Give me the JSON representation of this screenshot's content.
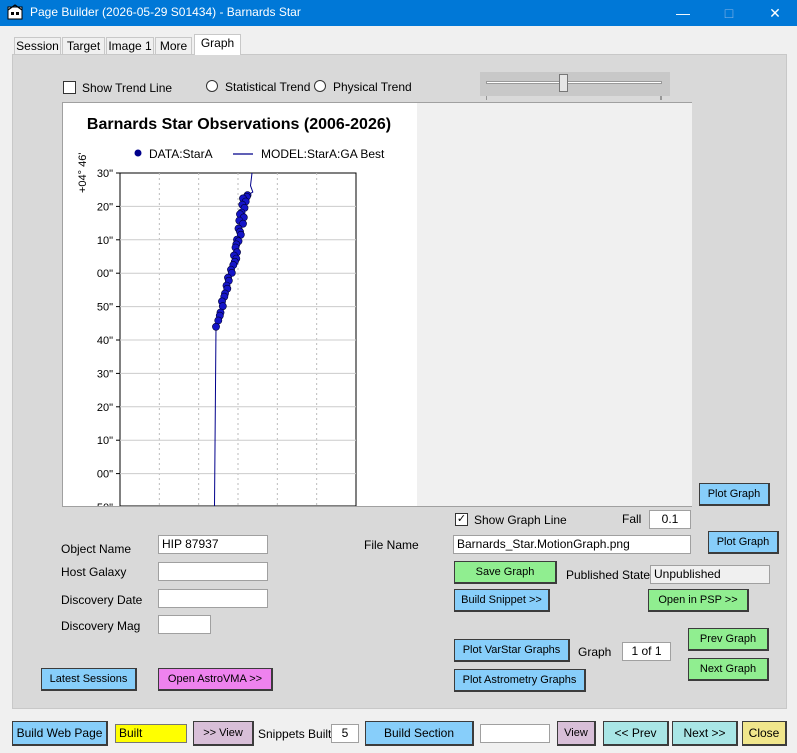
{
  "window": {
    "title": "Page Builder (2026-05-29 S01434) - Barnards Star"
  },
  "tabs": [
    {
      "label": "Session"
    },
    {
      "label": "Target"
    },
    {
      "label": "Image 1"
    },
    {
      "label": "More"
    },
    {
      "label": "Graph",
      "active": true
    }
  ],
  "trend": {
    "show_trend_line": "Show Trend Line",
    "show_trend_line_checked": false,
    "statistical": "Statistical Trend",
    "physical": "Physical Trend",
    "slider_value": 0.45
  },
  "chart_data": {
    "type": "scatter",
    "title": "Barnards Star Observations (2006-2026)",
    "ylabel_top": "+04° 46'",
    "y_ticks": [
      "30\"",
      "20\"",
      "10\"",
      "00\"",
      "50\"",
      "40\"",
      "30\"",
      "20\"",
      "10\"",
      "00\"",
      "50\""
    ],
    "legend": [
      {
        "name": "DATA:StarA",
        "marker": "dot",
        "color": "#00008b"
      },
      {
        "name": "MODEL:StarA:GA Best",
        "marker": "line",
        "color": "#00008b"
      }
    ],
    "series": [
      {
        "name": "DATA:StarA",
        "points": [
          [
            0.5,
            0.26
          ],
          [
            0.45,
            0.25
          ],
          [
            0.2,
            0.24
          ],
          [
            0.38,
            0.22
          ],
          [
            0.15,
            0.2
          ],
          [
            0.3,
            0.18
          ],
          [
            0.1,
            0.15
          ],
          [
            0.0,
            0.14
          ],
          [
            0.25,
            0.12
          ],
          [
            -0.05,
            0.1
          ],
          [
            0.2,
            0.08
          ],
          [
            -0.1,
            0.05
          ],
          [
            0.0,
            0.03
          ],
          [
            0.05,
            0.01
          ],
          [
            -0.2,
            -0.02
          ],
          [
            -0.1,
            -0.03
          ],
          [
            -0.25,
            -0.05
          ],
          [
            -0.3,
            -0.07
          ],
          [
            -0.2,
            -0.1
          ],
          [
            -0.4,
            -0.12
          ],
          [
            -0.25,
            -0.14
          ],
          [
            -0.35,
            -0.16
          ],
          [
            -0.45,
            -0.18
          ],
          [
            -0.6,
            -0.21
          ],
          [
            -0.55,
            -0.23
          ],
          [
            -0.8,
            -0.26
          ],
          [
            -0.75,
            -0.28
          ],
          [
            -0.9,
            -0.31
          ],
          [
            -0.85,
            -0.33
          ],
          [
            -1.0,
            -0.36
          ],
          [
            -1.05,
            -0.38
          ],
          [
            -1.2,
            -0.41
          ],
          [
            -1.15,
            -0.44
          ],
          [
            -1.3,
            -0.48
          ],
          [
            -1.35,
            -0.5
          ],
          [
            -1.45,
            -0.53
          ],
          [
            -1.6,
            -0.57
          ]
        ]
      },
      {
        "name": "MODEL:StarA:GA Best"
      }
    ],
    "ylim": [
      -1.7,
      0.4
    ],
    "xlim": [
      -1,
      1
    ]
  },
  "plot_graph_top": "Plot Graph",
  "graph_line": {
    "label": "Show Graph Line",
    "checked": true,
    "fall_label": "Fall",
    "fall_value": "0.1"
  },
  "form": {
    "object_name_label": "Object Name",
    "object_name": "HIP 87937",
    "host_galaxy_label": "Host Galaxy",
    "host_galaxy": "",
    "discovery_date_label": "Discovery Date",
    "discovery_date": "",
    "discovery_mag_label": "Discovery Mag",
    "discovery_mag": ""
  },
  "file": {
    "label": "File Name",
    "value": "Barnards_Star.MotionGraph.png",
    "plot_graph": "Plot Graph",
    "save_graph": "Save Graph",
    "published_state_label": "Published State",
    "published_state": "Unpublished",
    "build_snippet": "Build Snippet >>",
    "open_in_psp": "Open in PSP >>"
  },
  "graphs": {
    "plot_varstar": "Plot VarStar Graphs",
    "graph_label": "Graph",
    "graph_index": "1 of 1",
    "prev_graph": "Prev Graph",
    "next_graph": "Next Graph",
    "plot_astrometry": "Plot Astrometry Graphs"
  },
  "left_buttons": {
    "latest_sessions": "Latest Sessions",
    "open_astrovma": "Open AstroVMA >>"
  },
  "bottom": {
    "build_web_page": "Build Web Page",
    "status": "Built",
    "view1": ">> View",
    "snippets_built_label": "Snippets Built",
    "snippets_built": "5",
    "build_section": "Build Section",
    "section_field": "",
    "view2": "View",
    "prev": "<< Prev",
    "next": "Next >>",
    "close": "Close"
  },
  "colors": {
    "titlebar": "#0078d7",
    "button_blue": "#87cefa",
    "button_green": "#90ee90",
    "button_pink": "#ee82ee",
    "status_yellow": "#ffff00",
    "data_points": "#00008b"
  }
}
